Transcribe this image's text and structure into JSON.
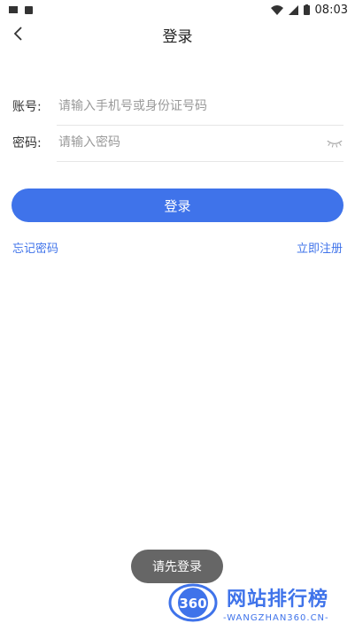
{
  "status_bar": {
    "time": "08:03"
  },
  "header": {
    "title": "登录"
  },
  "form": {
    "account_label": "账号:",
    "account_placeholder": "请输入手机号或身份证号码",
    "password_label": "密码:",
    "password_placeholder": "请输入密码"
  },
  "actions": {
    "login_label": "登录",
    "forgot_password": "忘记密码",
    "register": "立即注册"
  },
  "toast": {
    "message": "请先登录"
  },
  "watermark": {
    "logo_text": "360",
    "brand": "网站排行榜",
    "domain": "-WANGZHAN360.CN-"
  },
  "colors": {
    "accent": "#3f73ea",
    "toast_bg": "#666666"
  }
}
